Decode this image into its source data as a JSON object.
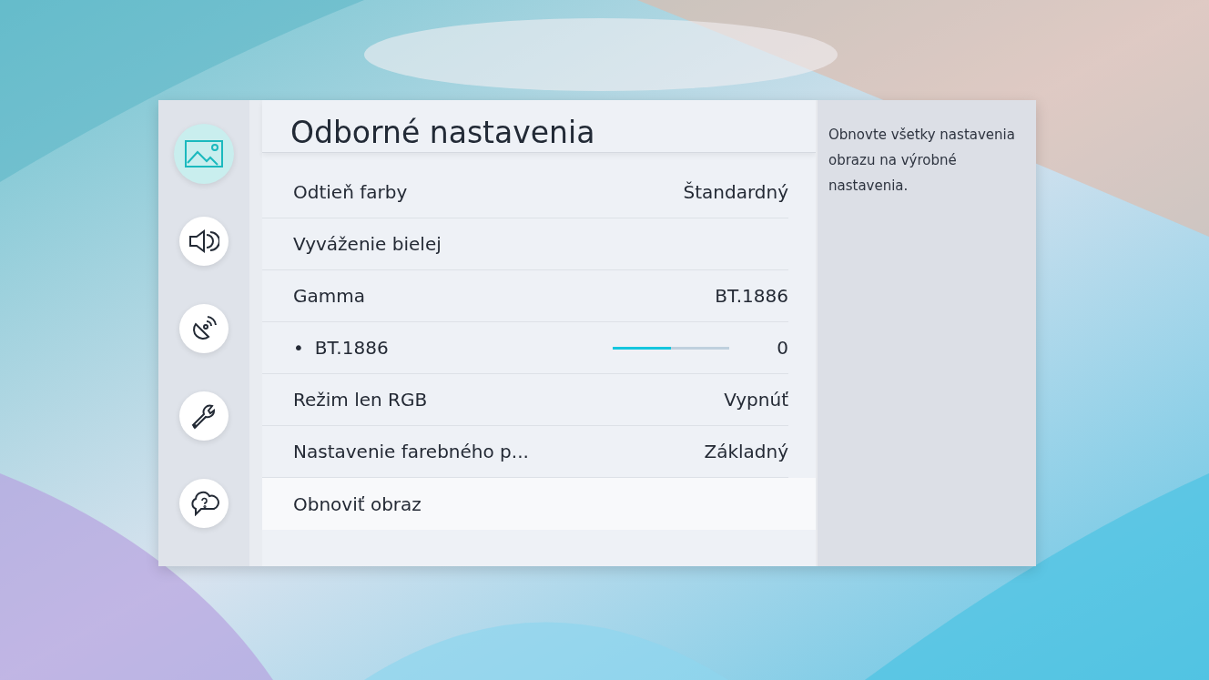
{
  "sidebar": {
    "items": [
      {
        "kind": "picture",
        "selected": true
      },
      {
        "kind": "sound",
        "selected": false
      },
      {
        "kind": "broadcast",
        "selected": false
      },
      {
        "kind": "wrench",
        "selected": false
      },
      {
        "kind": "support",
        "selected": false
      }
    ]
  },
  "title": "Odborné nastavenia",
  "rows": [
    {
      "kind": "value",
      "label": "Odtieň farby",
      "value": "Štandardný",
      "selected": false
    },
    {
      "kind": "plain",
      "label": "Vyváženie bielej",
      "selected": false
    },
    {
      "kind": "value",
      "label": "Gamma",
      "value": "BT.1886",
      "selected": false
    },
    {
      "kind": "slider",
      "bullet": "•",
      "label": "BT.1886",
      "level": 0.5,
      "value": "0",
      "selected": false
    },
    {
      "kind": "value",
      "label": "Režim len RGB",
      "value": "Vypnúť",
      "selected": false
    },
    {
      "kind": "value",
      "label": "Nastavenie farebného p...",
      "value": "Základný",
      "selected": false
    },
    {
      "kind": "plain",
      "label": "Obnoviť obraz",
      "selected": true
    }
  ],
  "description": "Obnovte všetky nastavenia obrazu na výrobné nastavenia."
}
